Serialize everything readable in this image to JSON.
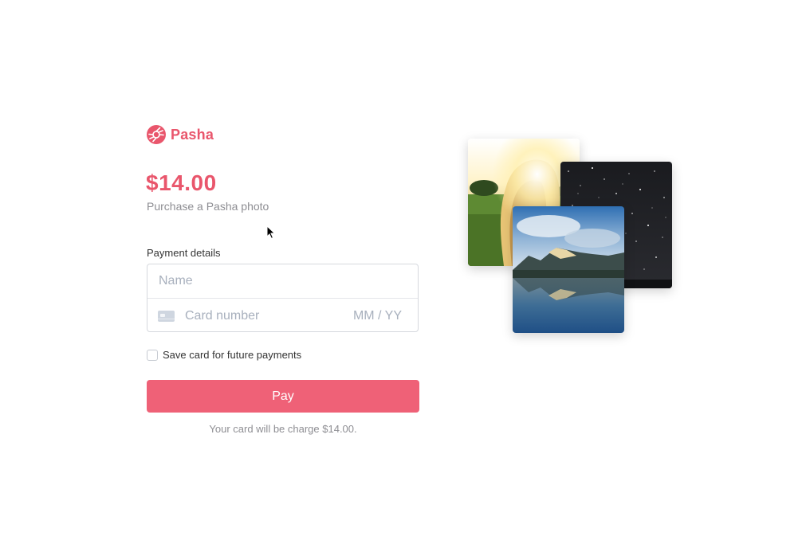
{
  "brand": {
    "name": "Pasha",
    "color": "#e9566c",
    "logo_icon": "aperture-icon"
  },
  "product": {
    "price": "$14.00",
    "description": "Purchase a Pasha photo"
  },
  "form": {
    "section_label": "Payment details",
    "name_placeholder": "Name",
    "card_placeholder": "Card number",
    "expiry_placeholder": "MM / YY",
    "card_icon": "credit-card-icon",
    "save_card_label": "Save card for future payments",
    "save_card_checked": false
  },
  "pay_button": {
    "label": "Pay",
    "color": "#ef6177"
  },
  "charge_note": "Your card will be charge $14.00.",
  "photos": [
    {
      "name": "sunset-field-photo"
    },
    {
      "name": "starry-night-photo"
    },
    {
      "name": "mountain-lake-photo"
    }
  ]
}
